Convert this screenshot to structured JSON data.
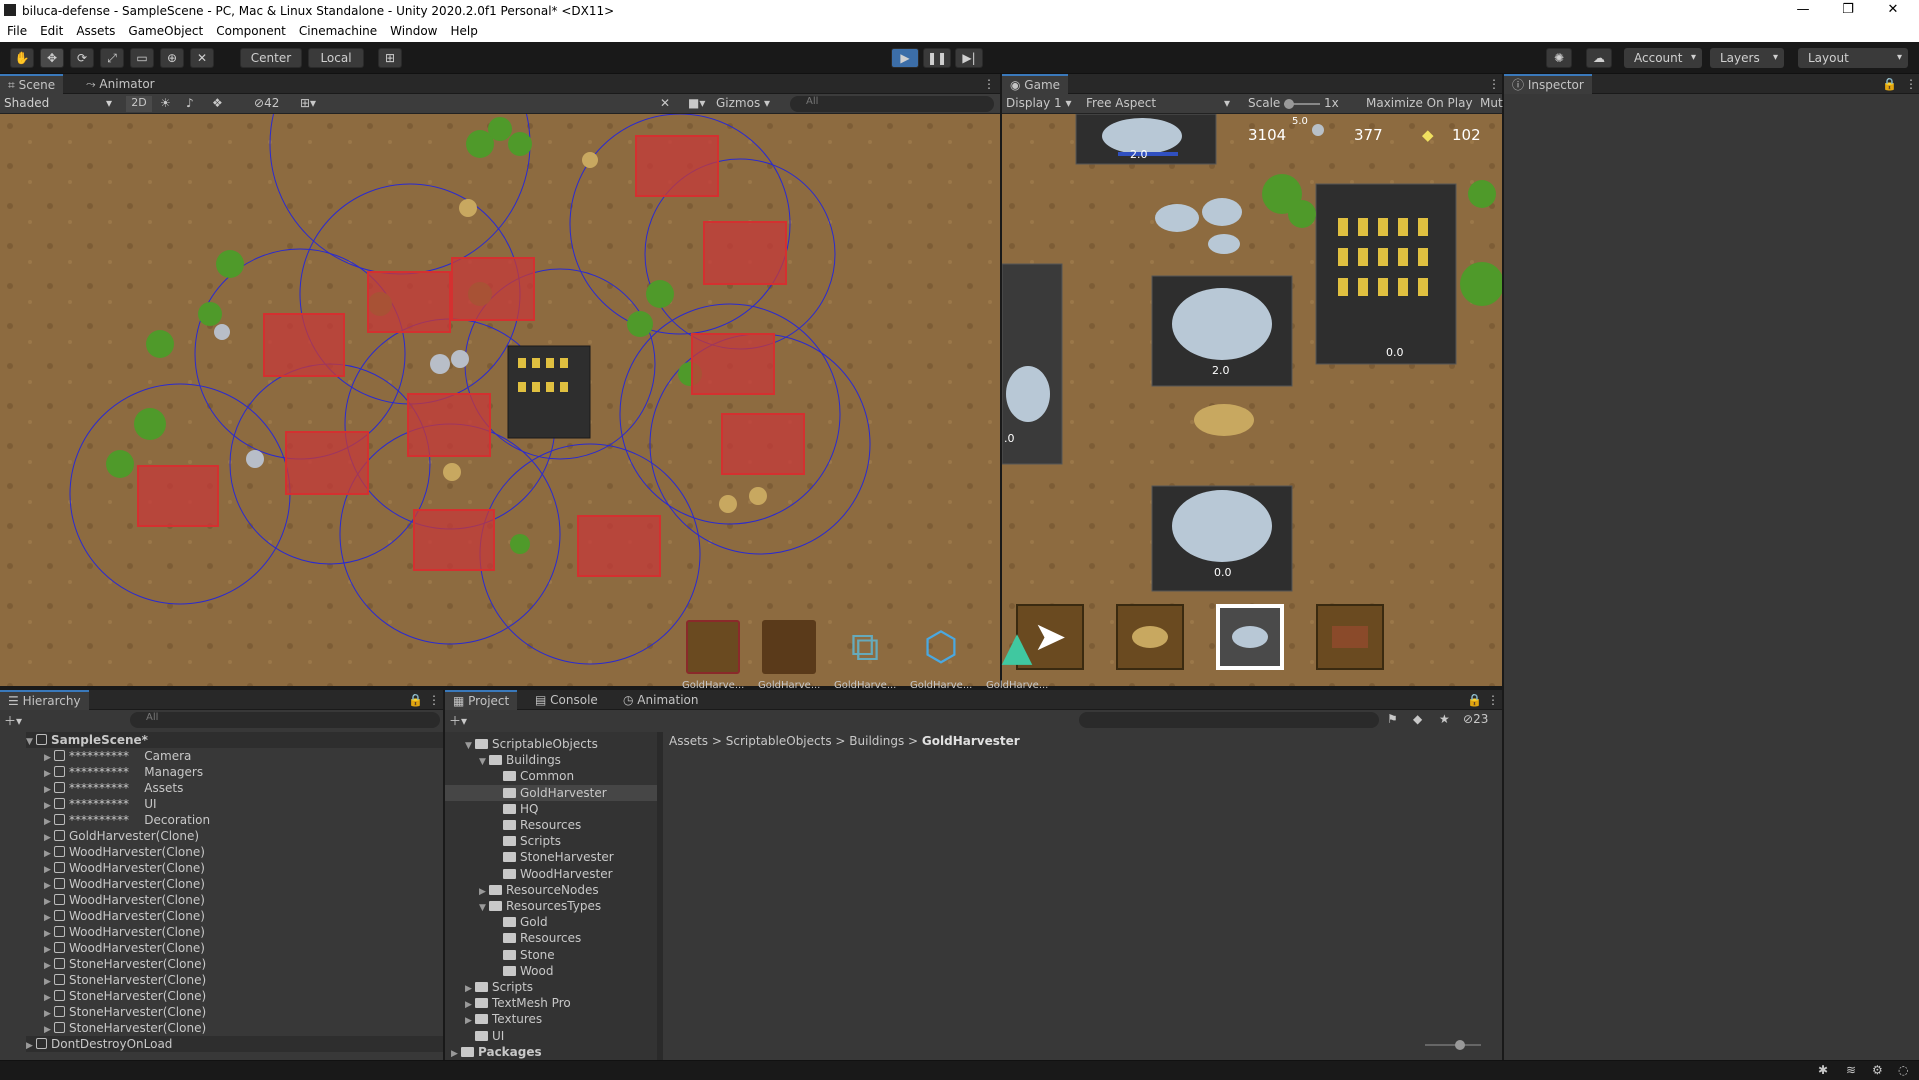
{
  "window": {
    "title": "biluca-defense - SampleScene - PC, Mac & Linux Standalone - Unity 2020.2.0f1 Personal* <DX11>",
    "min": "—",
    "max": "❐",
    "close": "✕"
  },
  "menu": [
    "File",
    "Edit",
    "Assets",
    "GameObject",
    "Component",
    "Cinemachine",
    "Window",
    "Help"
  ],
  "toolbar": {
    "center": "Center",
    "local": "Local",
    "account": "Account",
    "layers": "Layers",
    "layout": "Layout"
  },
  "scene": {
    "tab": "Scene",
    "tab2": "Animator",
    "shading": "Shaded",
    "mode2d": "2D",
    "hidden_count": "42",
    "gizmos": "Gizmos",
    "search_placeholder": "All"
  },
  "game": {
    "tab": "Game",
    "display": "Display 1",
    "aspect": "Free Aspect",
    "scale_label": "Scale",
    "scale_value": "1x",
    "maximize": "Maximize On Play",
    "mute": "Mut",
    "hud": {
      "wood": "3104",
      "stone": "377",
      "gold": "102",
      "top_value": "5.0"
    },
    "labels": [
      "2.0",
      "2.0",
      "0.0",
      "0.0",
      ".0"
    ]
  },
  "inspector": {
    "tab": "Inspector"
  },
  "hierarchy": {
    "tab": "Hierarchy",
    "search_placeholder": "All",
    "scene": "SampleScene*",
    "groups": [
      {
        "stars": "**********",
        "name": "Camera"
      },
      {
        "stars": "**********",
        "name": "Managers"
      },
      {
        "stars": "**********",
        "name": "Assets"
      },
      {
        "stars": "**********",
        "name": "UI"
      },
      {
        "stars": "**********",
        "name": "Decoration"
      }
    ],
    "items": [
      "GoldHarvester(Clone)",
      "WoodHarvester(Clone)",
      "WoodHarvester(Clone)",
      "WoodHarvester(Clone)",
      "WoodHarvester(Clone)",
      "WoodHarvester(Clone)",
      "WoodHarvester(Clone)",
      "WoodHarvester(Clone)",
      "StoneHarvester(Clone)",
      "StoneHarvester(Clone)",
      "StoneHarvester(Clone)",
      "StoneHarvester(Clone)",
      "StoneHarvester(Clone)"
    ],
    "ddol": "DontDestroyOnLoad"
  },
  "project": {
    "tabs": [
      "Project",
      "Console",
      "Animation"
    ],
    "hidden_count": "23",
    "tree": [
      {
        "t": "ScriptableObjects",
        "d": 1,
        "open": true
      },
      {
        "t": "Buildings",
        "d": 2,
        "open": true
      },
      {
        "t": "Common",
        "d": 3
      },
      {
        "t": "GoldHarvester",
        "d": 3,
        "sel": true
      },
      {
        "t": "HQ",
        "d": 3
      },
      {
        "t": "Resources",
        "d": 3
      },
      {
        "t": "Scripts",
        "d": 3
      },
      {
        "t": "StoneHarvester",
        "d": 3
      },
      {
        "t": "WoodHarvester",
        "d": 3
      },
      {
        "t": "ResourceNodes",
        "d": 2,
        "arrow": true
      },
      {
        "t": "ResourcesTypes",
        "d": 2,
        "open": true
      },
      {
        "t": "Gold",
        "d": 3
      },
      {
        "t": "Resources",
        "d": 3
      },
      {
        "t": "Stone",
        "d": 3
      },
      {
        "t": "Wood",
        "d": 3
      },
      {
        "t": "Scripts",
        "d": 1,
        "arrow": true
      },
      {
        "t": "TextMesh Pro",
        "d": 1,
        "arrow": true
      },
      {
        "t": "Textures",
        "d": 1,
        "arrow": true
      },
      {
        "t": "UI",
        "d": 1
      },
      {
        "t": "Packages",
        "d": 0,
        "arrow": true,
        "bold": true
      }
    ],
    "breadcrumb": [
      "Assets",
      "ScriptableObjects",
      "Buildings",
      "GoldHarvester"
    ],
    "assets": [
      "GoldHarve...",
      "GoldHarve...",
      "GoldHarve...",
      "GoldHarve...",
      "GoldHarve..."
    ]
  }
}
